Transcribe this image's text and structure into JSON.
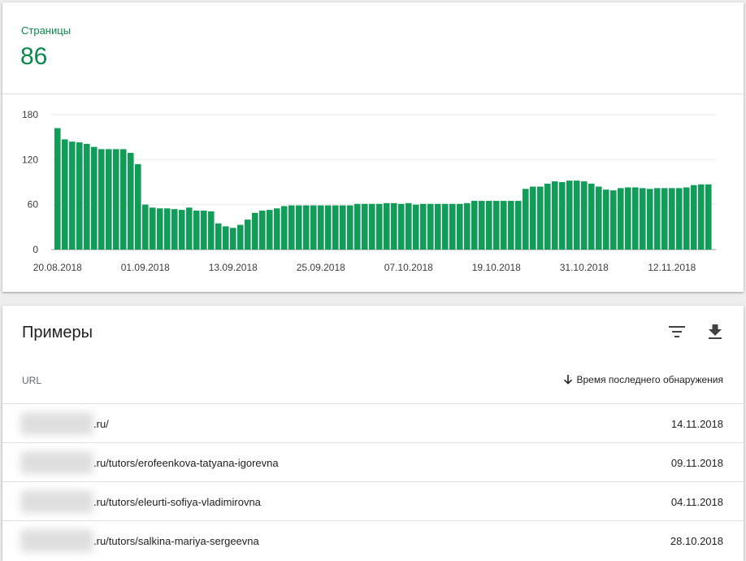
{
  "summary": {
    "label": "Страницы",
    "value": "86"
  },
  "chart_data": {
    "type": "bar",
    "color": "#0f9d58",
    "ylim": [
      0,
      180
    ],
    "y_ticks": [
      "180",
      "120",
      "60",
      "0"
    ],
    "x_tick_labels": [
      "20.08.2018",
      "01.09.2018",
      "13.09.2018",
      "25.09.2018",
      "07.10.2018",
      "19.10.2018",
      "31.10.2018",
      "12.11.2018"
    ],
    "x_start": "20.08.2018",
    "grid": true,
    "values": [
      162,
      147,
      144,
      143,
      141,
      137,
      134,
      134,
      134,
      134,
      129,
      114,
      60,
      56,
      55,
      55,
      54,
      53,
      56,
      52,
      52,
      51,
      35,
      31,
      29,
      33,
      40,
      49,
      52,
      53,
      55,
      58,
      59,
      59,
      59,
      59,
      59,
      59,
      59,
      59,
      59,
      61,
      61,
      61,
      61,
      62,
      62,
      61,
      62,
      60,
      61,
      61,
      61,
      61,
      61,
      61,
      62,
      65,
      65,
      65,
      65,
      65,
      65,
      65,
      81,
      84,
      84,
      88,
      91,
      90,
      92,
      92,
      91,
      88,
      84,
      80,
      79,
      82,
      83,
      83,
      82,
      81,
      82,
      82,
      82,
      82,
      83,
      86,
      87,
      87
    ]
  },
  "examples": {
    "title": "Примеры",
    "filter_icon": "filter-icon",
    "download_icon": "download-icon",
    "col_url": "URL",
    "col_date": "Время последнего обнаружения",
    "rows": [
      {
        "url": ".ru/",
        "date": "14.11.2018"
      },
      {
        "url": ".ru/tutors/erofeenkova-tatyana-igorevna",
        "date": "09.11.2018"
      },
      {
        "url": ".ru/tutors/eleurti-sofiya-vladimirovna",
        "date": "04.11.2018"
      },
      {
        "url": ".ru/tutors/salkina-mariya-sergeevna",
        "date": "28.10.2018"
      }
    ]
  }
}
